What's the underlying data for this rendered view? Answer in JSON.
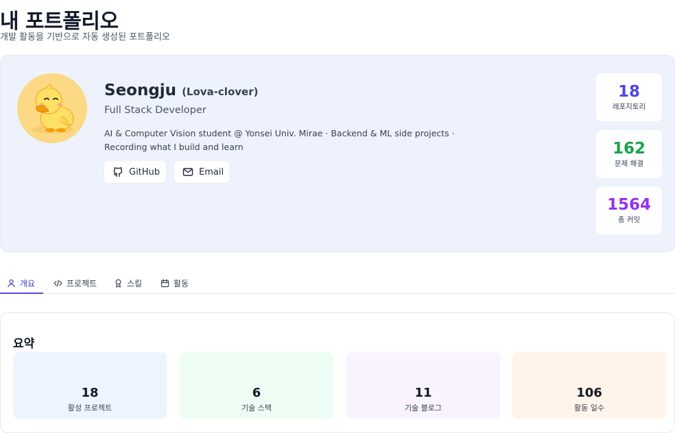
{
  "header": {
    "title": "내 포트폴리오",
    "subtitle": "개발 활동을 기반으로 자동 생성된 포트폴리오"
  },
  "profile": {
    "name": "Seongju",
    "handle": "(Lova-clover)",
    "role": "Full Stack Developer",
    "bio_line1": "AI & Computer Vision student @ Yonsei Univ. Mirae · Backend & ML side projects ·",
    "bio_line2": "Recording what I build and learn",
    "github_label": "GitHub",
    "email_label": "Email"
  },
  "stats": [
    {
      "value": "18",
      "label": "레포지토리",
      "color": "#4f46e5"
    },
    {
      "value": "162",
      "label": "문제 해결",
      "color": "#16a34a"
    },
    {
      "value": "1564",
      "label": "총 커밋",
      "color": "#9333ea"
    }
  ],
  "tabs": [
    {
      "label": "개요",
      "icon": "user-icon",
      "active": true
    },
    {
      "label": "프로젝트",
      "icon": "code-icon"
    },
    {
      "label": "스킬",
      "icon": "award-icon"
    },
    {
      "label": "활동",
      "icon": "calendar-icon"
    }
  ],
  "summary": {
    "title": "요약",
    "items": [
      {
        "value": "18",
        "label": "활성 프로젝트"
      },
      {
        "value": "6",
        "label": "기술 스택"
      },
      {
        "value": "11",
        "label": "기술 블로그"
      },
      {
        "value": "106",
        "label": "활동 일수"
      }
    ]
  }
}
